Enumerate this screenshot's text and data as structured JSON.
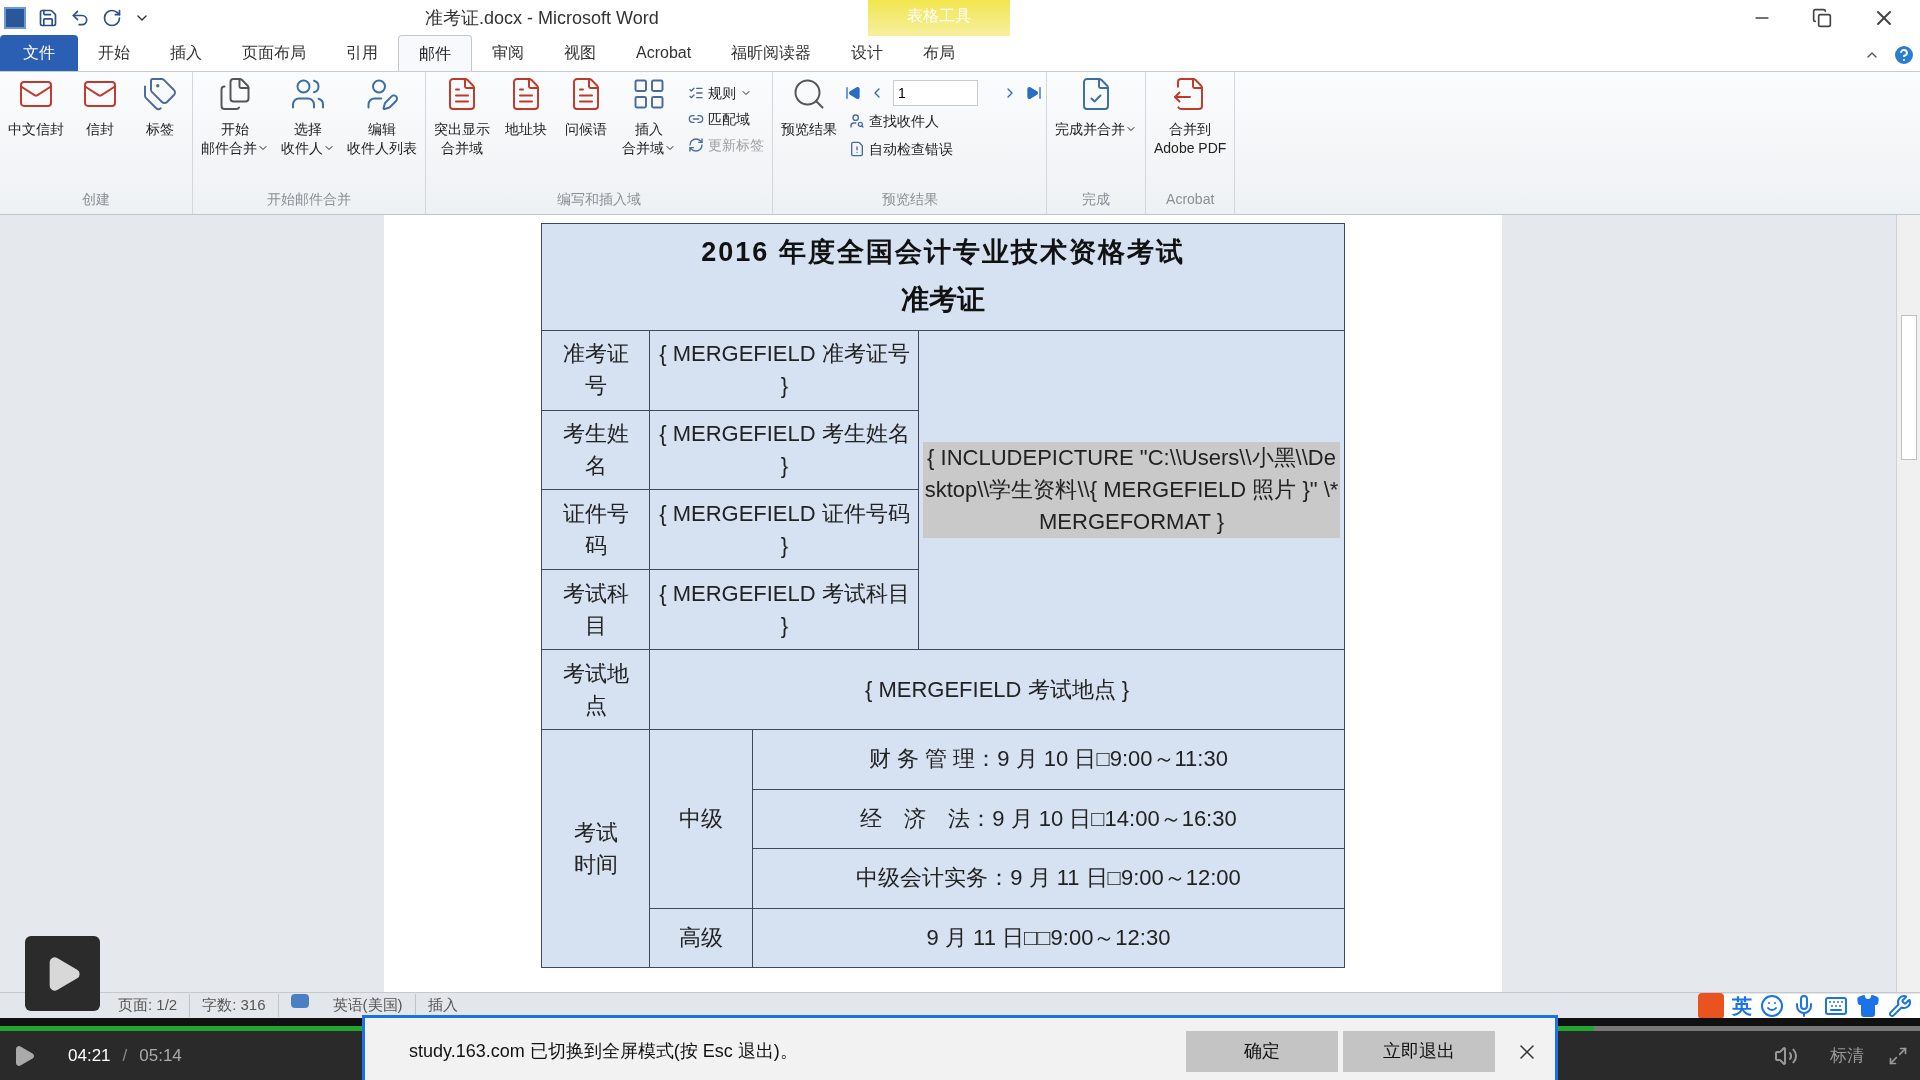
{
  "window": {
    "title": "准考证.docx - Microsoft Word",
    "context_group": "表格工具"
  },
  "ribbon_tabs": [
    {
      "label": "文件",
      "kind": "file",
      "selected": false
    },
    {
      "label": "开始",
      "kind": "normal",
      "selected": false
    },
    {
      "label": "插入",
      "kind": "normal",
      "selected": false
    },
    {
      "label": "页面布局",
      "kind": "normal",
      "selected": false
    },
    {
      "label": "引用",
      "kind": "normal",
      "selected": false
    },
    {
      "label": "邮件",
      "kind": "normal",
      "selected": true
    },
    {
      "label": "审阅",
      "kind": "normal",
      "selected": false
    },
    {
      "label": "视图",
      "kind": "normal",
      "selected": false
    },
    {
      "label": "Acrobat",
      "kind": "normal",
      "selected": false
    },
    {
      "label": "福昕阅读器",
      "kind": "normal",
      "selected": false
    },
    {
      "label": "设计",
      "kind": "context",
      "selected": false
    },
    {
      "label": "布局",
      "kind": "context",
      "selected": false
    }
  ],
  "ribbon_groups": [
    {
      "name": "创建",
      "items": [
        {
          "kind": "large",
          "lines": [
            "中文信封"
          ],
          "dropdown": false
        },
        {
          "kind": "large",
          "lines": [
            "信封"
          ],
          "dropdown": false
        },
        {
          "kind": "large",
          "lines": [
            "标签"
          ],
          "dropdown": false
        }
      ]
    },
    {
      "name": "开始邮件合并",
      "items": [
        {
          "kind": "large",
          "lines": [
            "开始",
            "邮件合并"
          ],
          "dropdown": true
        },
        {
          "kind": "large",
          "lines": [
            "选择",
            "收件人"
          ],
          "dropdown": true
        },
        {
          "kind": "large",
          "lines": [
            "编辑",
            "收件人列表"
          ],
          "dropdown": false
        }
      ]
    },
    {
      "name": "编写和插入域",
      "items": [
        {
          "kind": "large",
          "lines": [
            "突出显示",
            "合并域"
          ],
          "dropdown": false
        },
        {
          "kind": "large",
          "lines": [
            "地址块"
          ],
          "dropdown": false
        },
        {
          "kind": "large",
          "lines": [
            "问候语"
          ],
          "dropdown": false
        },
        {
          "kind": "large",
          "lines": [
            "插入",
            "合并域"
          ],
          "dropdown": true
        },
        {
          "kind": "stack",
          "rows": [
            {
              "label": "规则",
              "dropdown": true,
              "disabled": false
            },
            {
              "label": "匹配域",
              "dropdown": false,
              "disabled": false
            },
            {
              "label": "更新标签",
              "dropdown": false,
              "disabled": true
            }
          ]
        }
      ]
    },
    {
      "name": "预览结果",
      "items": [
        {
          "kind": "large",
          "lines": [
            "预览结果"
          ],
          "dropdown": false
        },
        {
          "kind": "nav",
          "value": "1",
          "rows": [
            {
              "label": "查找收件人",
              "dropdown": false,
              "disabled": false
            },
            {
              "label": "自动检查错误",
              "dropdown": false,
              "disabled": false
            }
          ]
        }
      ]
    },
    {
      "name": "完成",
      "items": [
        {
          "kind": "large",
          "lines": [
            "完成并合并"
          ],
          "dropdown": true
        }
      ]
    },
    {
      "name": "Acrobat",
      "items": [
        {
          "kind": "large",
          "lines": [
            "合并到",
            "Adobe PDF"
          ],
          "dropdown": false
        }
      ]
    }
  ],
  "document": {
    "title": "2016 年度全国会计专业技术资格考试",
    "subtitle": "准考证",
    "fields": [
      {
        "label": "准考证号",
        "value": "{ MERGEFIELD 准考证号 }"
      },
      {
        "label": "考生姓名",
        "value": "{ MERGEFIELD 考生姓名 }"
      },
      {
        "label": "证件号码",
        "value": "{ MERGEFIELD 证件号码 }"
      },
      {
        "label": "考试科目",
        "value": "{ MERGEFIELD 考试科目 }"
      }
    ],
    "photo_field": "{ INCLUDEPICTURE \"C:\\\\Users\\\\小黑\\\\Desktop\\\\学生资料\\\\{ MERGEFIELD 照片 }\" \\* MERGEFORMAT }",
    "location": {
      "label": "考试地点",
      "value": "{ MERGEFIELD 考试地点 }"
    },
    "schedule": {
      "label": "考试时间",
      "levels": [
        {
          "name": "中级",
          "sessions": [
            "财 务 管 理：9 月 10 日□9:00～11:30",
            "经　济　法：9 月 10 日□14:00～16:30",
            "中级会计实务：9 月 11 日□9:00～12:00"
          ]
        },
        {
          "name": "高级",
          "sessions": [
            "9 月 11 日□□9:00～12:30"
          ]
        }
      ]
    }
  },
  "status_bar": {
    "page": "页面: 1/2",
    "words": "字数: 316",
    "language": "英语(美国)",
    "mode": "插入"
  },
  "ime": {
    "mode": "英"
  },
  "player": {
    "current": "04:21",
    "separator": "/",
    "duration": "05:14",
    "quality": "标清",
    "progress": {
      "level": 0.83
    }
  },
  "notice": {
    "message": "study.163.com 已切换到全屏模式(按 Esc 退出)。",
    "buttons": [
      "确定",
      "立即退出"
    ]
  }
}
